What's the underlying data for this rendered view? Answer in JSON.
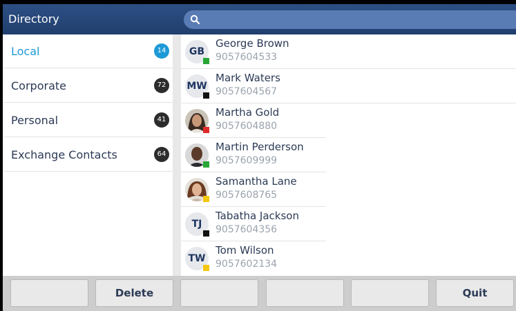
{
  "header": {
    "title": "Directory"
  },
  "colors": {
    "active": "#1d9ad6",
    "header": "#2c4f83",
    "available": "#27a835",
    "busy": "#e02a2a",
    "away": "#f4c712",
    "offline": "#111111"
  },
  "categories": [
    {
      "label": "Local",
      "count": "14",
      "active": true
    },
    {
      "label": "Corporate",
      "count": "72",
      "active": false
    },
    {
      "label": "Personal",
      "count": "41",
      "active": false
    },
    {
      "label": "Exchange Contacts",
      "count": "64",
      "active": false
    }
  ],
  "contacts": [
    {
      "name": "George Brown",
      "number": "9057604533",
      "initials": "GB",
      "status": "available",
      "photo": false
    },
    {
      "name": "Mark Waters",
      "number": "9057604567",
      "initials": "MW",
      "status": "offline",
      "photo": false
    },
    {
      "name": "Martha Gold",
      "number": "9057604880",
      "initials": "",
      "status": "busy",
      "photo": true
    },
    {
      "name": "Martin Perderson",
      "number": "9057609999",
      "initials": "",
      "status": "available",
      "photo": true
    },
    {
      "name": "Samantha Lane",
      "number": "9057608765",
      "initials": "",
      "status": "away",
      "photo": true
    },
    {
      "name": "Tabatha Jackson",
      "number": "9057604356",
      "initials": "TJ",
      "status": "offline",
      "photo": false
    },
    {
      "name": "Tom Wilson",
      "number": "9057602134",
      "initials": "TW",
      "status": "away",
      "photo": false
    }
  ],
  "softkeys": [
    "",
    "Delete",
    "",
    "",
    "",
    "Quit"
  ]
}
